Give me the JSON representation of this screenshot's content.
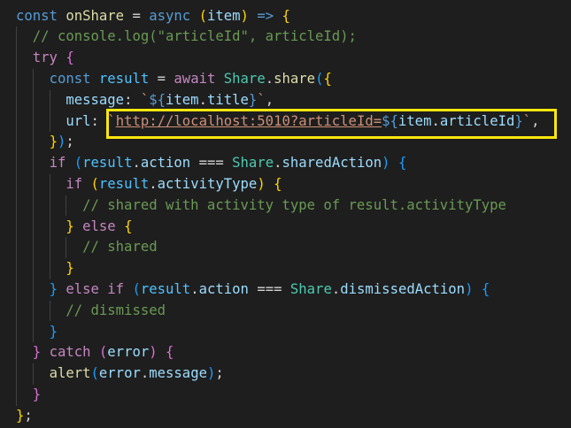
{
  "editor": {
    "background": "#1e1e1e",
    "highlight_color": "#fce70d",
    "lines": [
      [
        {
          "t": "const",
          "c": "k-blue"
        },
        {
          "t": " ",
          "c": "k-punc"
        },
        {
          "t": "onShare",
          "c": "k-fn"
        },
        {
          "t": " = ",
          "c": "k-punc"
        },
        {
          "t": "async",
          "c": "k-blue"
        },
        {
          "t": " ",
          "c": "k-punc"
        },
        {
          "t": "(",
          "c": "b-gold"
        },
        {
          "t": "item",
          "c": "k-var"
        },
        {
          "t": ")",
          "c": "b-gold"
        },
        {
          "t": " ",
          "c": "k-punc"
        },
        {
          "t": "=>",
          "c": "k-blue"
        },
        {
          "t": " ",
          "c": "k-punc"
        },
        {
          "t": "{",
          "c": "b-gold"
        }
      ],
      [
        {
          "t": "  ",
          "c": "k-punc"
        },
        {
          "t": "// console.log(\"articleId\", articleId);",
          "c": "k-cmt"
        }
      ],
      [
        {
          "t": "  ",
          "c": "k-punc"
        },
        {
          "t": "try",
          "c": "k-purple"
        },
        {
          "t": " ",
          "c": "k-punc"
        },
        {
          "t": "{",
          "c": "b-pink"
        }
      ],
      [
        {
          "t": "    ",
          "c": "k-punc"
        },
        {
          "t": "const",
          "c": "k-blue"
        },
        {
          "t": " ",
          "c": "k-punc"
        },
        {
          "t": "result",
          "c": "k-const"
        },
        {
          "t": " = ",
          "c": "k-punc"
        },
        {
          "t": "await",
          "c": "k-purple"
        },
        {
          "t": " ",
          "c": "k-punc"
        },
        {
          "t": "Share",
          "c": "k-class"
        },
        {
          "t": ".",
          "c": "k-punc"
        },
        {
          "t": "share",
          "c": "k-fn"
        },
        {
          "t": "(",
          "c": "b-blue"
        },
        {
          "t": "{",
          "c": "b-gold"
        }
      ],
      [
        {
          "t": "      ",
          "c": "k-punc"
        },
        {
          "t": "message",
          "c": "k-var"
        },
        {
          "t": ": ",
          "c": "k-punc"
        },
        {
          "t": "`",
          "c": "k-str"
        },
        {
          "t": "${",
          "c": "k-tpl"
        },
        {
          "t": "item",
          "c": "k-var"
        },
        {
          "t": ".",
          "c": "k-punc"
        },
        {
          "t": "title",
          "c": "k-var"
        },
        {
          "t": "}",
          "c": "k-tpl"
        },
        {
          "t": "`",
          "c": "k-str"
        },
        {
          "t": ",",
          "c": "k-punc"
        }
      ],
      [
        {
          "t": "      ",
          "c": "k-punc"
        },
        {
          "t": "url",
          "c": "k-var"
        },
        {
          "t": ": ",
          "c": "k-punc"
        },
        {
          "t": "`",
          "c": "k-str"
        },
        {
          "t": "http://localhost:5010?articleId=",
          "c": "k-str-u"
        },
        {
          "t": "${",
          "c": "k-tpl"
        },
        {
          "t": "item",
          "c": "k-var"
        },
        {
          "t": ".",
          "c": "k-punc"
        },
        {
          "t": "articleId",
          "c": "k-var"
        },
        {
          "t": "}",
          "c": "k-tpl"
        },
        {
          "t": "`",
          "c": "k-str"
        },
        {
          "t": ",",
          "c": "k-punc"
        }
      ],
      [
        {
          "t": "    ",
          "c": "k-punc"
        },
        {
          "t": "}",
          "c": "b-gold"
        },
        {
          "t": ")",
          "c": "b-blue"
        },
        {
          "t": ";",
          "c": "k-punc"
        }
      ],
      [
        {
          "t": "    ",
          "c": "k-punc"
        },
        {
          "t": "if",
          "c": "k-purple"
        },
        {
          "t": " ",
          "c": "k-punc"
        },
        {
          "t": "(",
          "c": "b-blue"
        },
        {
          "t": "result",
          "c": "k-const"
        },
        {
          "t": ".",
          "c": "k-punc"
        },
        {
          "t": "action",
          "c": "k-var"
        },
        {
          "t": " === ",
          "c": "k-punc"
        },
        {
          "t": "Share",
          "c": "k-class"
        },
        {
          "t": ".",
          "c": "k-punc"
        },
        {
          "t": "sharedAction",
          "c": "k-var"
        },
        {
          "t": ")",
          "c": "b-blue"
        },
        {
          "t": " ",
          "c": "k-punc"
        },
        {
          "t": "{",
          "c": "b-blue"
        }
      ],
      [
        {
          "t": "      ",
          "c": "k-punc"
        },
        {
          "t": "if",
          "c": "k-purple"
        },
        {
          "t": " ",
          "c": "k-punc"
        },
        {
          "t": "(",
          "c": "b-gold"
        },
        {
          "t": "result",
          "c": "k-const"
        },
        {
          "t": ".",
          "c": "k-punc"
        },
        {
          "t": "activityType",
          "c": "k-var"
        },
        {
          "t": ")",
          "c": "b-gold"
        },
        {
          "t": " ",
          "c": "k-punc"
        },
        {
          "t": "{",
          "c": "b-gold"
        }
      ],
      [
        {
          "t": "        ",
          "c": "k-punc"
        },
        {
          "t": "// shared with activity type of result.activityType",
          "c": "k-cmt"
        }
      ],
      [
        {
          "t": "      ",
          "c": "k-punc"
        },
        {
          "t": "}",
          "c": "b-gold"
        },
        {
          "t": " ",
          "c": "k-punc"
        },
        {
          "t": "else",
          "c": "k-purple"
        },
        {
          "t": " ",
          "c": "k-punc"
        },
        {
          "t": "{",
          "c": "b-gold"
        }
      ],
      [
        {
          "t": "        ",
          "c": "k-punc"
        },
        {
          "t": "// shared",
          "c": "k-cmt"
        }
      ],
      [
        {
          "t": "      ",
          "c": "k-punc"
        },
        {
          "t": "}",
          "c": "b-gold"
        }
      ],
      [
        {
          "t": "    ",
          "c": "k-punc"
        },
        {
          "t": "}",
          "c": "b-blue"
        },
        {
          "t": " ",
          "c": "k-punc"
        },
        {
          "t": "else",
          "c": "k-purple"
        },
        {
          "t": " ",
          "c": "k-punc"
        },
        {
          "t": "if",
          "c": "k-purple"
        },
        {
          "t": " ",
          "c": "k-punc"
        },
        {
          "t": "(",
          "c": "b-blue"
        },
        {
          "t": "result",
          "c": "k-const"
        },
        {
          "t": ".",
          "c": "k-punc"
        },
        {
          "t": "action",
          "c": "k-var"
        },
        {
          "t": " === ",
          "c": "k-punc"
        },
        {
          "t": "Share",
          "c": "k-class"
        },
        {
          "t": ".",
          "c": "k-punc"
        },
        {
          "t": "dismissedAction",
          "c": "k-var"
        },
        {
          "t": ")",
          "c": "b-blue"
        },
        {
          "t": " ",
          "c": "k-punc"
        },
        {
          "t": "{",
          "c": "b-blue"
        }
      ],
      [
        {
          "t": "      ",
          "c": "k-punc"
        },
        {
          "t": "// dismissed",
          "c": "k-cmt"
        }
      ],
      [
        {
          "t": "    ",
          "c": "k-punc"
        },
        {
          "t": "}",
          "c": "b-blue"
        }
      ],
      [
        {
          "t": "  ",
          "c": "k-punc"
        },
        {
          "t": "}",
          "c": "b-pink"
        },
        {
          "t": " ",
          "c": "k-punc"
        },
        {
          "t": "catch",
          "c": "k-purple"
        },
        {
          "t": " ",
          "c": "k-punc"
        },
        {
          "t": "(",
          "c": "b-pink"
        },
        {
          "t": "error",
          "c": "k-var"
        },
        {
          "t": ")",
          "c": "b-pink"
        },
        {
          "t": " ",
          "c": "k-punc"
        },
        {
          "t": "{",
          "c": "b-pink"
        }
      ],
      [
        {
          "t": "    ",
          "c": "k-punc"
        },
        {
          "t": "alert",
          "c": "k-fn"
        },
        {
          "t": "(",
          "c": "b-blue"
        },
        {
          "t": "error",
          "c": "k-var"
        },
        {
          "t": ".",
          "c": "k-punc"
        },
        {
          "t": "message",
          "c": "k-var"
        },
        {
          "t": ")",
          "c": "b-blue"
        },
        {
          "t": ";",
          "c": "k-punc"
        }
      ],
      [
        {
          "t": "  ",
          "c": "k-punc"
        },
        {
          "t": "}",
          "c": "b-pink"
        }
      ],
      [
        {
          "t": "}",
          "c": "b-gold"
        },
        {
          "t": ";",
          "c": "k-punc"
        }
      ]
    ]
  }
}
